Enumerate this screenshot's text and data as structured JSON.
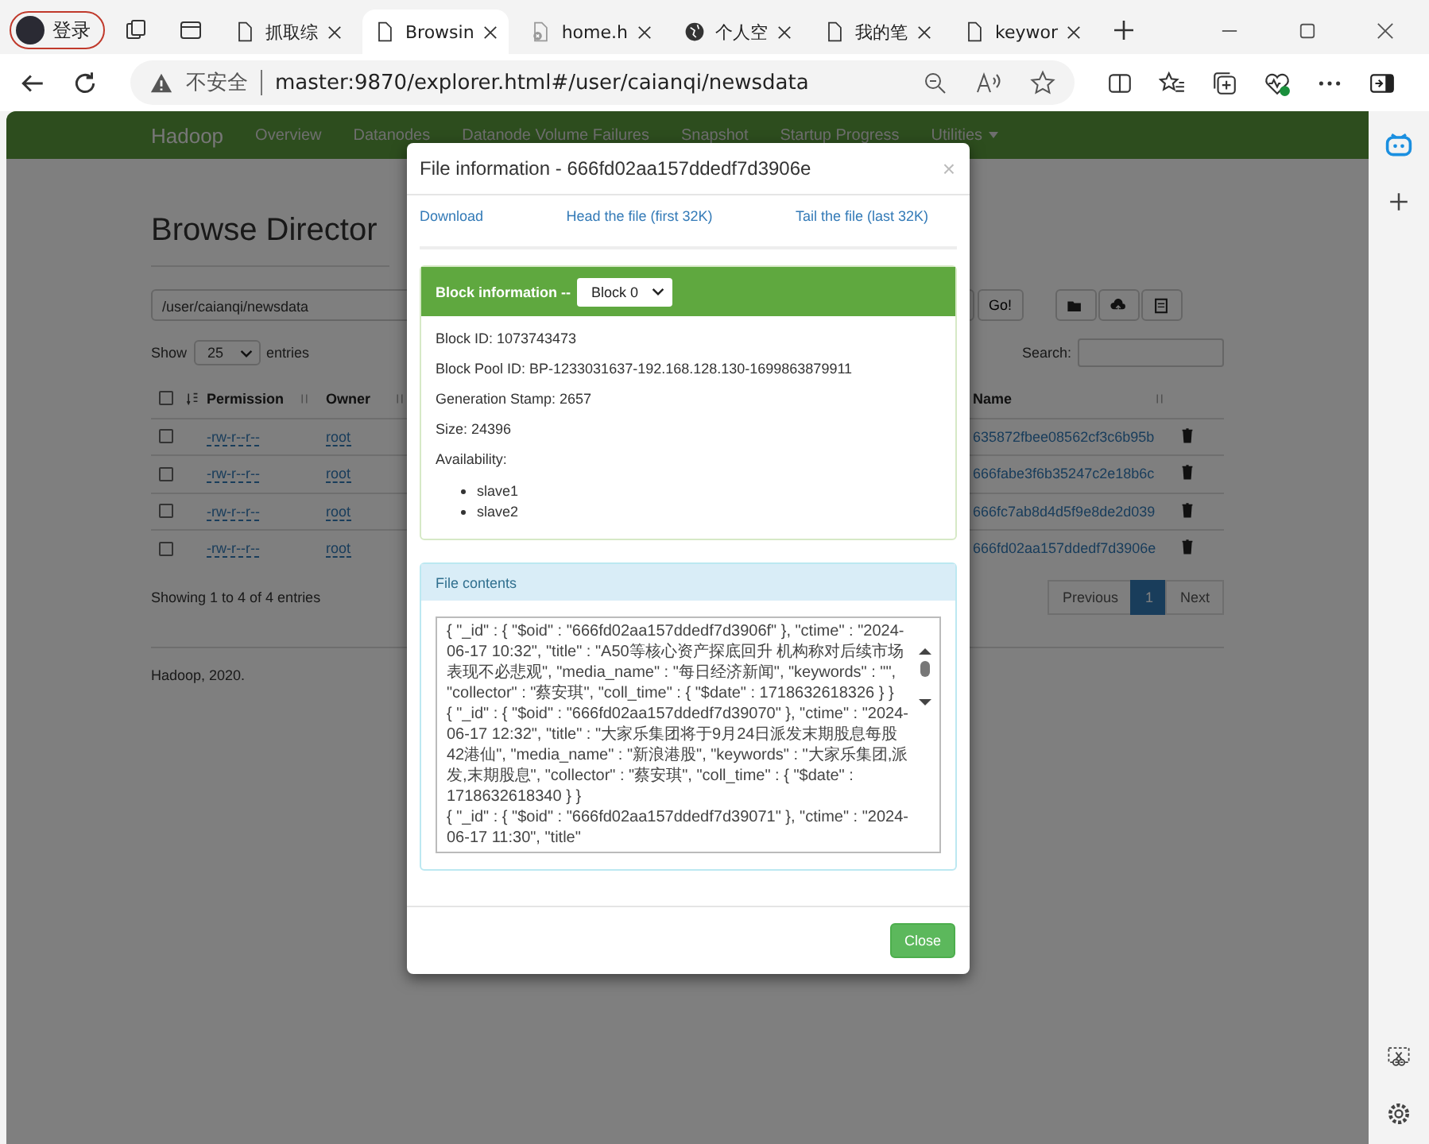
{
  "browser": {
    "profile": {
      "label": "登录"
    },
    "tabs": [
      {
        "title": "抓取综",
        "kind": "page",
        "selected": false
      },
      {
        "title": "Browsin",
        "kind": "page",
        "selected": true
      },
      {
        "title": "home.h",
        "kind": "error",
        "selected": false
      },
      {
        "title": "个人空",
        "kind": "globe",
        "selected": false
      },
      {
        "title": "我的笔",
        "kind": "page",
        "selected": false
      },
      {
        "title": "keywor",
        "kind": "page",
        "selected": false
      }
    ],
    "address_bar": {
      "security": "不安全",
      "url": "master:9870/explorer.html#/user/caianqi/newsdata"
    }
  },
  "page": {
    "navbar": {
      "brand": "Hadoop",
      "items": [
        {
          "label": "Overview",
          "dropdown": false
        },
        {
          "label": "Datanodes",
          "dropdown": false
        },
        {
          "label": "Datanode Volume Failures",
          "dropdown": false
        },
        {
          "label": "Snapshot",
          "dropdown": false
        },
        {
          "label": "Startup Progress",
          "dropdown": false
        },
        {
          "label": "Utilities",
          "dropdown": true
        }
      ]
    },
    "heading": "Browse Director",
    "path": "/user/caianqi/newsdata",
    "go": "Go!",
    "show": "Show",
    "page_size": "25",
    "entries": "entries",
    "search_label": "Search:",
    "table": {
      "select_all_checked": false,
      "columns": [
        "Permission",
        "Owner",
        "Name"
      ],
      "rows": [
        {
          "checked": false,
          "permission": "-rw-r--r--",
          "owner": "root",
          "name": "635872fbee08562cf3c6b95b"
        },
        {
          "checked": false,
          "permission": "-rw-r--r--",
          "owner": "root",
          "name": "666fabe3f6b35247c2e18b6c"
        },
        {
          "checked": false,
          "permission": "-rw-r--r--",
          "owner": "root",
          "name": "666fc7ab8d4d5f9e8de2d039"
        },
        {
          "checked": false,
          "permission": "-rw-r--r--",
          "owner": "root",
          "name": "666fd02aa157ddedf7d3906e"
        }
      ]
    },
    "summary": "Showing 1 to 4 of 4 entries",
    "pagination": [
      {
        "label": "Previous",
        "selected": false
      },
      {
        "label": "1",
        "selected": true
      },
      {
        "label": "Next",
        "selected": false
      }
    ],
    "footer": "Hadoop, 2020."
  },
  "modal": {
    "title": "File information - 666fd02aa157ddedf7d3906e",
    "close": "×",
    "links": [
      "Download",
      "Head the file (first 32K)",
      "Tail the file (last 32K)"
    ],
    "block_panel": {
      "heading": "Block information --",
      "block": "Block 0",
      "lines": [
        "Block ID: 1073743473",
        "Block Pool ID: BP-1233031637-192.168.128.130-1699863879911",
        "Generation Stamp: 2657",
        "Size: 24396",
        "Availability:"
      ],
      "hosts": [
        "slave1",
        "slave2"
      ]
    },
    "contents_panel": {
      "heading": "File contents",
      "records": [
        "{ \"_id\" : { \"$oid\" : \"666fd02aa157ddedf7d3906f\" }, \"ctime\" : \"2024-06-17 10:32\", \"title\" : \"A50等核心资产探底回升 机构称对后续市场表现不必悲观\", \"media_name\" : \"每日经济新闻\", \"keywords\" : \"\", \"collector\" : \"蔡安琪\", \"coll_time\" : { \"$date\" : 1718632618326 } }",
        "{ \"_id\" : { \"$oid\" : \"666fd02aa157ddedf7d39070\" }, \"ctime\" : \"2024-06-17 12:32\", \"title\" : \"大家乐集团将于9月24日派发末期股息每股42港仙\", \"media_name\" : \"新浪港股\", \"keywords\" : \"大家乐集团,派发,末期股息\", \"collector\" : \"蔡安琪\", \"coll_time\" : { \"$date\" : 1718632618340 } }",
        "{ \"_id\" : { \"$oid\" : \"666fd02aa157ddedf7d39071\" }, \"ctime\" : \"2024-06-17 11:30\", \"title\""
      ]
    },
    "footer_button": "Close"
  }
}
